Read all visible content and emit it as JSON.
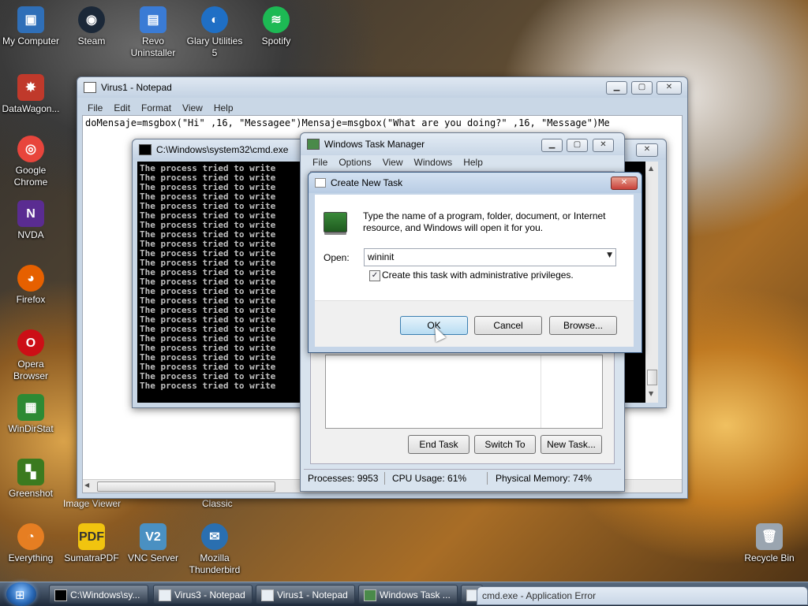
{
  "desktop": {
    "icons": [
      {
        "label": "My Computer",
        "color": "#2f6fb8"
      },
      {
        "label": "Steam",
        "color": "#1b2838"
      },
      {
        "label": "Revo Uninstaller",
        "color": "#3a7bd5"
      },
      {
        "label": "Glary Utilities 5",
        "color": "#1f6fc5"
      },
      {
        "label": "Spotify",
        "color": "#1db954"
      },
      {
        "label": "DataWagon...",
        "color": "#c0392b"
      },
      {
        "label": "Google Chrome",
        "color": "#e8453c"
      },
      {
        "label": "NVDA",
        "color": "#5a2c91"
      },
      {
        "label": "Firefox",
        "color": "#e66000"
      },
      {
        "label": "Opera Browser",
        "color": "#cc0f16"
      },
      {
        "label": "WinDirStat",
        "color": "#2d8a34"
      },
      {
        "label": "Greenshot",
        "color": "#3b7a1f"
      },
      {
        "label": "Everything",
        "color": "#e67e22"
      },
      {
        "label": "SumatraPDF",
        "color": "#f1c40f"
      },
      {
        "label": "VNC Server",
        "color": "#4a90c2"
      },
      {
        "label": "Mozilla Thunderbird",
        "color": "#2a6fb0"
      },
      {
        "label": "Recycle Bin",
        "color": "#9aa5b0"
      }
    ],
    "partial_labels": {
      "image_viewer": "Image Viewer",
      "classic": "Classic"
    }
  },
  "notepad": {
    "title": "Virus1 - Notepad",
    "menu": [
      "File",
      "Edit",
      "Format",
      "View",
      "Help"
    ],
    "content": "doMensaje=msgbox(\"Hi\" ,16, \"Messagee\")Mensaje=msgbox(\"What are you doing?\" ,16, \"Message\")Me"
  },
  "cmd": {
    "title": "C:\\Windows\\system32\\cmd.exe",
    "line": "The process tried to write",
    "line_count": 24
  },
  "taskmgr": {
    "title": "Windows Task Manager",
    "menu": [
      "File",
      "Options",
      "View",
      "Windows",
      "Help"
    ],
    "buttons": {
      "end_task": "End Task",
      "switch_to": "Switch To",
      "new_task": "New Task..."
    },
    "status": {
      "processes": "Processes: 9953",
      "cpu": "CPU Usage: 61%",
      "memory": "Physical Memory: 74%"
    }
  },
  "dialog": {
    "title": "Create New Task",
    "description": "Type the name of a program, folder, document, or Internet resource, and Windows will open it for you.",
    "open_label": "Open:",
    "open_value": "wininit",
    "admin_checkbox_label": "Create this task with administrative privileges.",
    "admin_checked": true,
    "buttons": {
      "ok": "OK",
      "cancel": "Cancel",
      "browse": "Browse..."
    }
  },
  "taskbar": {
    "items": [
      {
        "label": "C:\\Windows\\sy..."
      },
      {
        "label": "Virus3 - Notepad"
      },
      {
        "label": "Virus1 - Notepad"
      },
      {
        "label": "Windows Task ..."
      },
      {
        "label": ""
      }
    ],
    "error_popup": "cmd.exe - Application Error"
  },
  "colors": {
    "accent": "#3c7fb1",
    "close_red": "#c8413a"
  }
}
